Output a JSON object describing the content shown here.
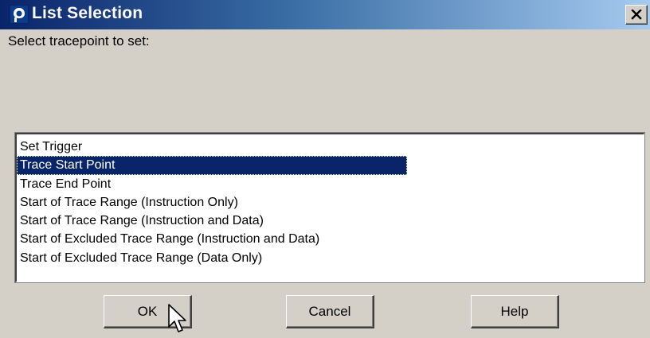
{
  "window": {
    "title": "List Selection",
    "close_glyph": "×",
    "icon": "app-window-icon"
  },
  "prompt_text": "Select tracepoint to set:",
  "list": {
    "items": [
      "Set Trigger",
      "Trace Start Point",
      "Trace End Point",
      "Start of Trace Range (Instruction Only)",
      "Start of Trace Range (Instruction and Data)",
      "Start of Excluded Trace Range (Instruction and Data)",
      "Start of Excluded Trace Range (Data Only)"
    ],
    "selected_index": 1,
    "selection_color": "#0a246a"
  },
  "buttons": {
    "ok_label": "OK",
    "cancel_label": "Cancel",
    "help_label": "Help"
  },
  "colors": {
    "face": "#d4d0c8",
    "title_start": "#0a246a",
    "title_end": "#a6caf0"
  }
}
